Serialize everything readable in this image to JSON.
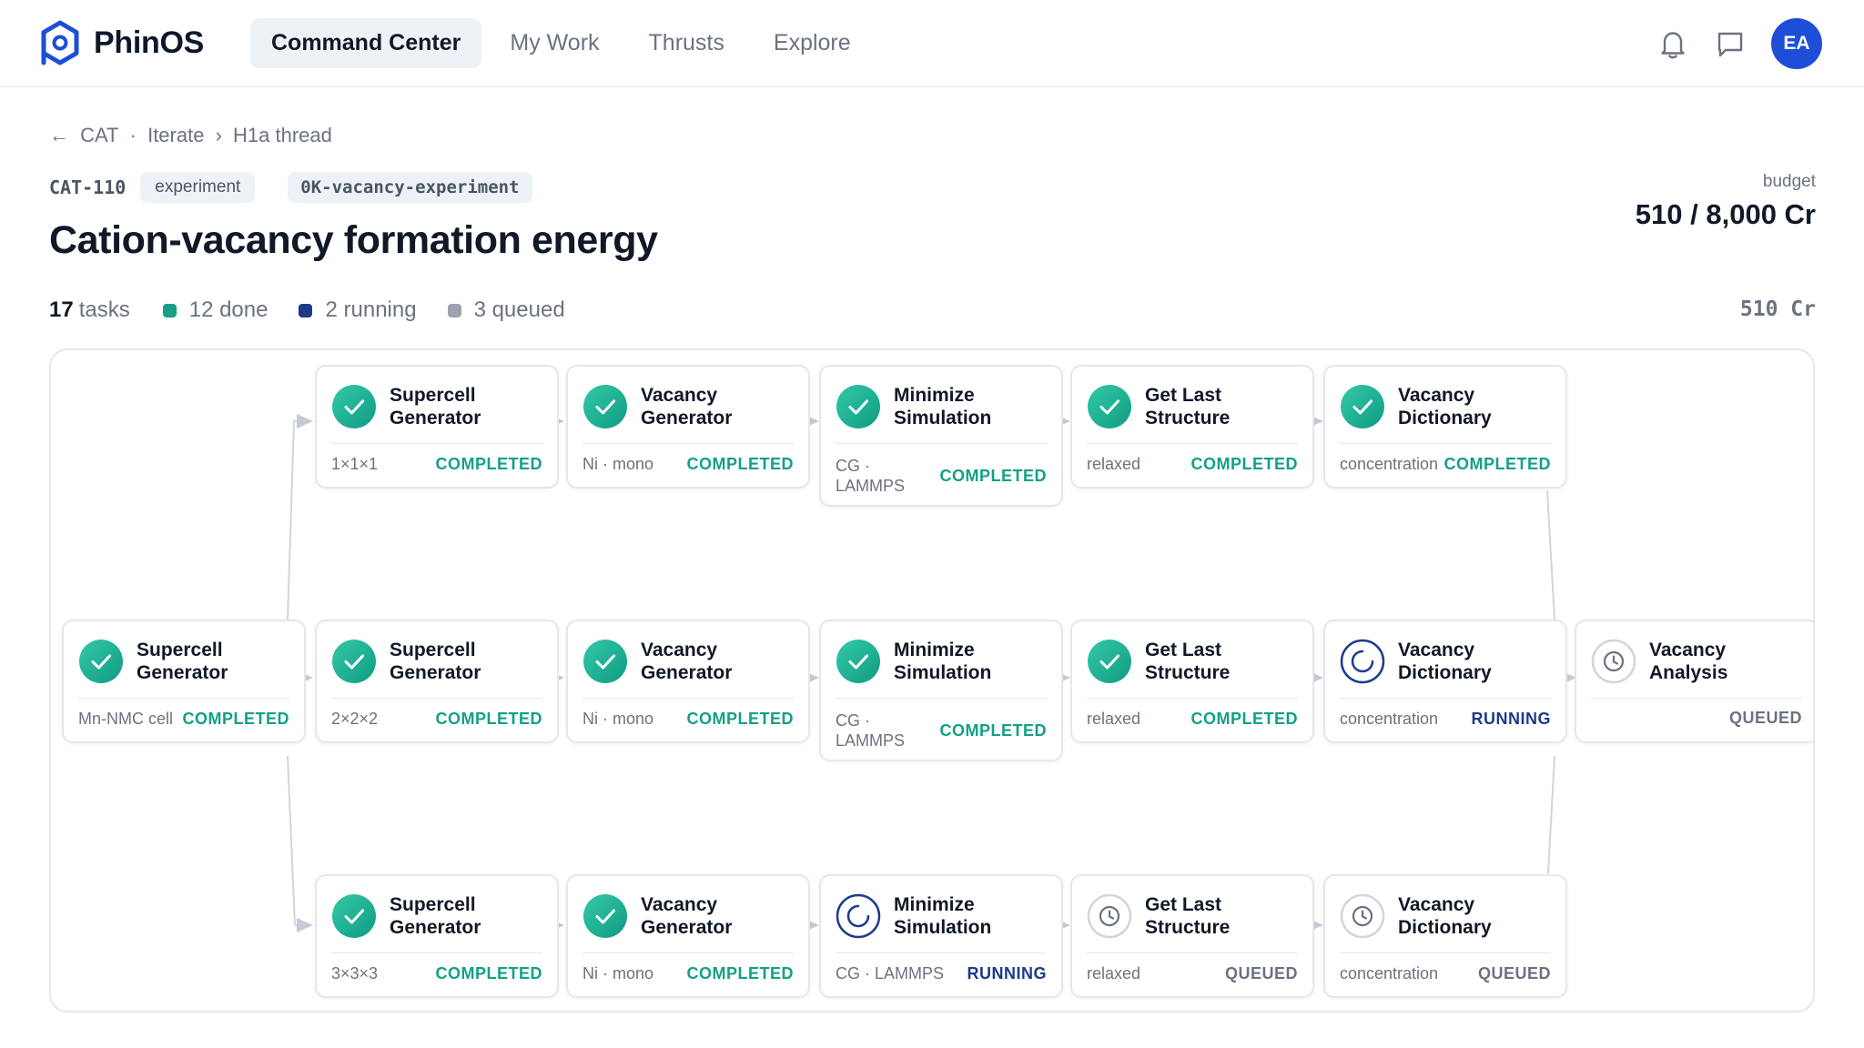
{
  "app": {
    "brand": "PhinOS"
  },
  "nav": [
    {
      "label": "Command Center",
      "active": true
    },
    {
      "label": "My Work",
      "active": false
    },
    {
      "label": "Thrusts",
      "active": false
    },
    {
      "label": "Explore",
      "active": false
    }
  ],
  "user": {
    "initials": "EA"
  },
  "breadcrumb": {
    "back": "←",
    "items": [
      "CAT",
      "·",
      "Iterate",
      "›",
      "H1a thread"
    ]
  },
  "experiment": {
    "id": "CAT-110",
    "type_tag": "experiment",
    "slug_tag": "0K-vacancy-experiment",
    "title": "Cation-vacancy formation energy"
  },
  "budget": {
    "label": "budget",
    "value": "510 / 8,000 Cr"
  },
  "stats": {
    "tasks_count": "17",
    "tasks_label": "tasks",
    "done": "12 done",
    "running": "2 running",
    "queued": "3 queued",
    "cost": "510 Cr"
  },
  "colors": {
    "done": "#14a085",
    "running": "#1e3a8a",
    "queued": "#9ca3af",
    "accent": "#1d4ed8"
  },
  "nodes": {
    "root": {
      "title": "Supercell Generator",
      "sub": "Mn-NMC cell",
      "status": "COMPLETED",
      "state": "done"
    },
    "r1": [
      {
        "title": "Supercell Generator",
        "sub": "1×1×1",
        "status": "COMPLETED",
        "state": "done"
      },
      {
        "title": "Vacancy Generator",
        "sub": "Ni · mono",
        "status": "COMPLETED",
        "state": "done"
      },
      {
        "title": "Minimize Simulation",
        "sub": "CG · LAMMPS",
        "status": "COMPLETED",
        "state": "done"
      },
      {
        "title": "Get Last Structure",
        "sub": "relaxed",
        "status": "COMPLETED",
        "state": "done"
      },
      {
        "title": "Vacancy Dictionary",
        "sub": "concentration",
        "status": "COMPLETED",
        "state": "done"
      }
    ],
    "r2": [
      {
        "title": "Supercell Generator",
        "sub": "2×2×2",
        "status": "COMPLETED",
        "state": "done"
      },
      {
        "title": "Vacancy Generator",
        "sub": "Ni · mono",
        "status": "COMPLETED",
        "state": "done"
      },
      {
        "title": "Minimize Simulation",
        "sub": "CG · LAMMPS",
        "status": "COMPLETED",
        "state": "done"
      },
      {
        "title": "Get Last Structure",
        "sub": "relaxed",
        "status": "COMPLETED",
        "state": "done"
      },
      {
        "title": "Vacancy Dictionary",
        "sub": "concentration",
        "status": "RUNNING",
        "state": "running"
      }
    ],
    "r3": [
      {
        "title": "Supercell Generator",
        "sub": "3×3×3",
        "status": "COMPLETED",
        "state": "done"
      },
      {
        "title": "Vacancy Generator",
        "sub": "Ni · mono",
        "status": "COMPLETED",
        "state": "done"
      },
      {
        "title": "Minimize Simulation",
        "sub": "CG · LAMMPS",
        "status": "RUNNING",
        "state": "running"
      },
      {
        "title": "Get Last Structure",
        "sub": "relaxed",
        "status": "QUEUED",
        "state": "queued"
      },
      {
        "title": "Vacancy Dictionary",
        "sub": "concentration",
        "status": "QUEUED",
        "state": "queued"
      }
    ],
    "analysis": {
      "title": "Vacancy Analysis",
      "sub": "",
      "status": "QUEUED",
      "state": "queued"
    }
  }
}
